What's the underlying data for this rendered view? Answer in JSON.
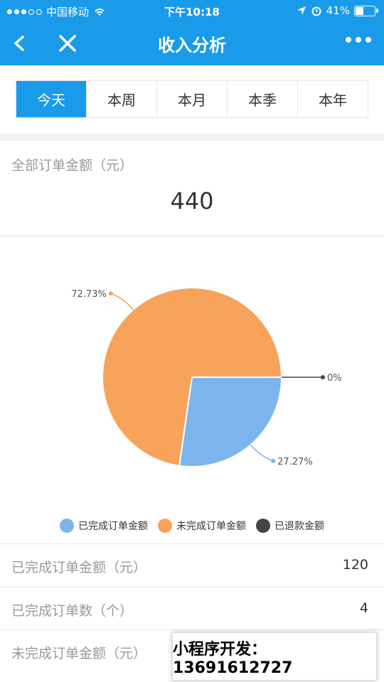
{
  "status_bar": {
    "carrier": "中国移动",
    "time": "下午10:18",
    "battery": "41%",
    "battery_level": 0.41
  },
  "nav": {
    "title": "收入分析"
  },
  "tabs": [
    {
      "label": "今天",
      "active": true
    },
    {
      "label": "本周"
    },
    {
      "label": "本月"
    },
    {
      "label": "本季"
    },
    {
      "label": "本年"
    }
  ],
  "summary": {
    "total_label": "全部订单金额（元）",
    "total_value": "440"
  },
  "colors": {
    "accent": "#1a9bea",
    "completed": "#7cb5ec",
    "incomplete": "#f7a35c",
    "refunded": "#434348"
  },
  "chart_data": {
    "type": "pie",
    "slices": [
      {
        "name": "已完成订单金额",
        "value": 27.27,
        "label": "27.27%"
      },
      {
        "name": "未完成订单金额",
        "value": 72.73,
        "label": "72.73%"
      },
      {
        "name": "已退款金额",
        "value": 0,
        "label": "0%"
      }
    ],
    "legend_placement": "bottom"
  },
  "legend": [
    {
      "label": "已完成订单金额"
    },
    {
      "label": "未完成订单金额"
    },
    {
      "label": "已退款金额"
    }
  ],
  "rows": [
    {
      "label": "已完成订单金额（元）",
      "value": "120"
    },
    {
      "label": "已完成订单数（个）",
      "value": "4"
    },
    {
      "label": "未完成订单金额（元）",
      "value": ""
    }
  ],
  "promo": {
    "text": "小程序开发：13691612727"
  }
}
